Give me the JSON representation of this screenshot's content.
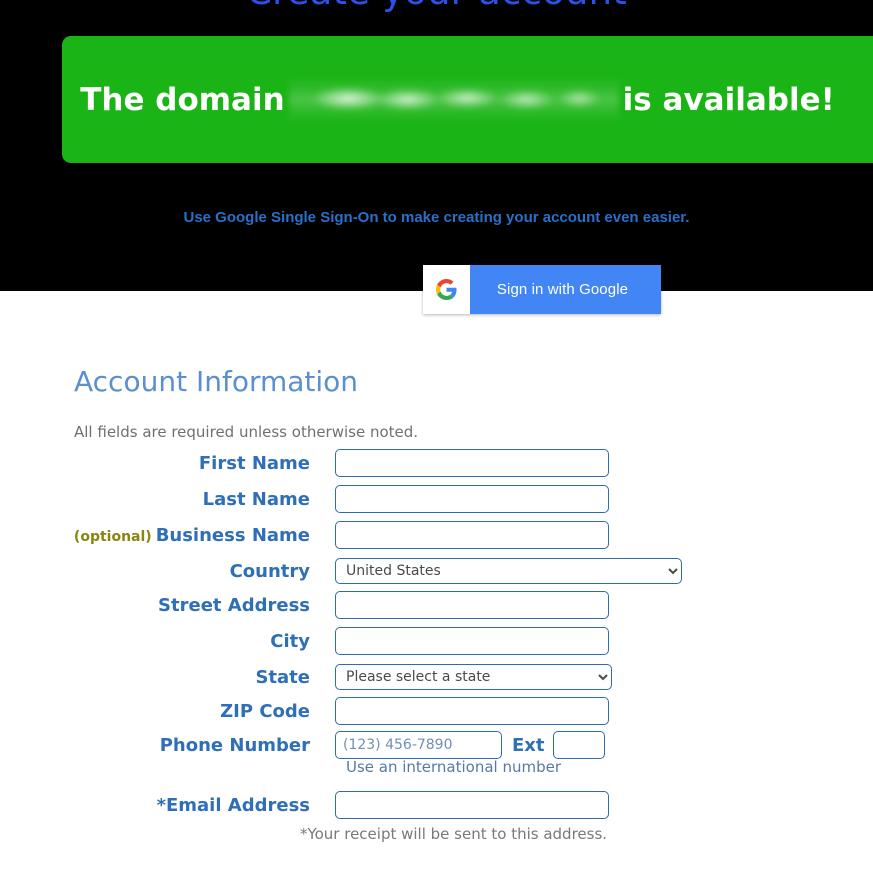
{
  "page": {
    "title": "Create your account",
    "title_color": "#2b52e8"
  },
  "banner": {
    "prefix": "The domain",
    "suffix": "is available!",
    "domain_redacted": "",
    "background_color": "#1bb416",
    "text_color": "#ffffff"
  },
  "sso": {
    "promo_text": "Use Google Single Sign-On to make creating your account even easier.",
    "promo_color": "#2870c9",
    "button_label": "Sign in with Google",
    "button_icon": "google-g-icon",
    "button_color": "#4285f4"
  },
  "form": {
    "section_title": "Account Information",
    "section_title_color": "#5b8fd0",
    "required_note": "All fields are required unless otherwise noted.",
    "optional_tag": "(optional)",
    "optional_tag_color": "#8a8410",
    "label_color": "#2e6fb7",
    "input_border_color": "#2d6cb0",
    "fields": [
      {
        "label": "First Name",
        "type": "text",
        "value": "",
        "placeholder": ""
      },
      {
        "label": "Last Name",
        "type": "text",
        "value": "",
        "placeholder": ""
      },
      {
        "label": "Business Name",
        "type": "text",
        "value": "",
        "placeholder": "",
        "optional": true
      },
      {
        "label": "Country",
        "type": "select",
        "value": "United States"
      },
      {
        "label": "Street Address",
        "type": "text",
        "value": "",
        "placeholder": ""
      },
      {
        "label": "City",
        "type": "text",
        "value": "",
        "placeholder": ""
      },
      {
        "label": "State",
        "type": "select",
        "value": "Please select a state"
      },
      {
        "label": "ZIP Code",
        "type": "text",
        "value": "",
        "placeholder": ""
      },
      {
        "label": "Phone Number",
        "type": "tel",
        "value": "",
        "placeholder": "(123) 456-7890"
      },
      {
        "label": "*Email Address",
        "type": "email",
        "value": "",
        "placeholder": ""
      }
    ],
    "ext_label": "Ext",
    "ext_value": "",
    "international_link": "Use an international number",
    "international_link_color": "#5878a6",
    "receipt_note": "*Your receipt will be sent to this address.",
    "receipt_note_color": "#76797d",
    "country_options": [
      "United States"
    ],
    "state_options": [
      "Please select a state"
    ]
  }
}
